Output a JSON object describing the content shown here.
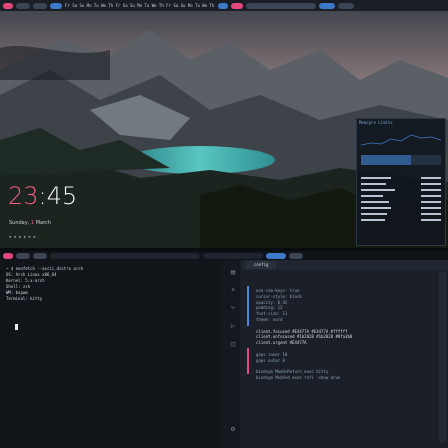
{
  "top": {
    "clock": {
      "hour": "23",
      "minute": "45",
      "sep": ":"
    },
    "date": {
      "day": "Sunday,",
      "day_num": "1",
      "month": "March"
    },
    "bar_text": "Fr Sa Su Mo Tu We Th Fr Sa Su Mo Tu We Th Fr Sa Su Mo Tu We Th Fr Sa Su Mo Tu We Th Fr",
    "widget": {
      "title": "Mem/pro Limits"
    }
  },
  "bottom": {
    "terminal_lines": [
      "~ $ neofetch --ascii_distro arch",
      "  OS: Arch Linux x86_64",
      "  Kernel: 5.x-arch",
      "  Shell: zsh",
      "  WM: bspwm",
      "  Terminal: kitty"
    ],
    "editor_tab": "config",
    "code_lines": [
      "use-vim-keys: true",
      "cursor-style: block",
      "opacity: 0.92",
      "padding: 12",
      "font-size: 11",
      "theme: nord",
      "",
      "client.focused  #E4477A  #E4477A  #ffffff",
      "client.unfocused  #1b2028  #1b2028  #8fa3b8",
      "client.urgent  #E4477A",
      "",
      "gaps inner 10",
      "gaps outer 0",
      "",
      "bindsym Mod4+Return exec kitty",
      "bindsym Mod4+d exec rofi -show drun"
    ]
  },
  "colors": {
    "accent": "#E4477A",
    "blue": "#3D79C9",
    "bg": "#161A1F"
  }
}
